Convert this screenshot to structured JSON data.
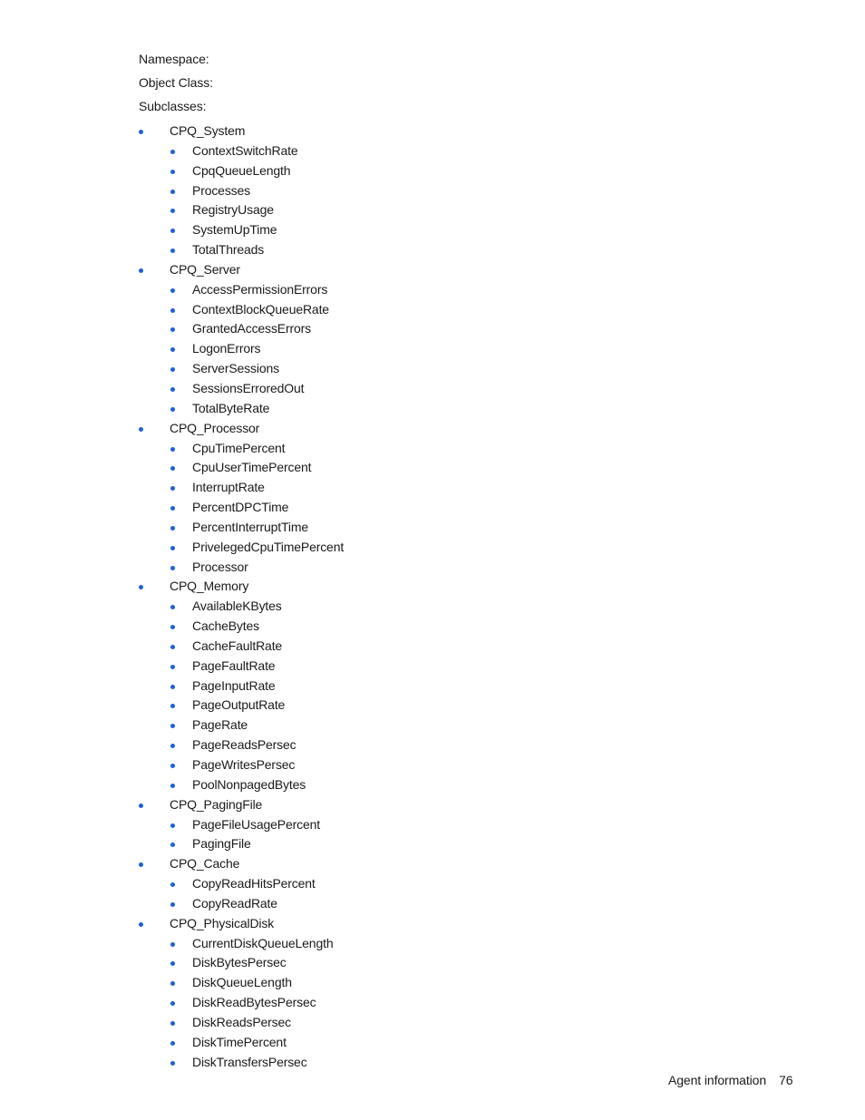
{
  "colors": {
    "bullet": "#1a62d6",
    "text": "#1a1a1a"
  },
  "fields": {
    "namespace_label": "Namespace:",
    "object_class_label": "Object Class:",
    "subclasses_label": "Subclasses:"
  },
  "subclasses": [
    {
      "name": "CPQ_System",
      "properties": [
        "ContextSwitchRate",
        "CpqQueueLength",
        "Processes",
        "RegistryUsage",
        "SystemUpTime",
        "TotalThreads"
      ]
    },
    {
      "name": "CPQ_Server",
      "properties": [
        "AccessPermissionErrors",
        "ContextBlockQueueRate",
        "GrantedAccessErrors",
        "LogonErrors",
        "ServerSessions",
        "SessionsErroredOut",
        "TotalByteRate"
      ]
    },
    {
      "name": "CPQ_Processor",
      "properties": [
        "CpuTimePercent",
        "CpuUserTimePercent",
        "InterruptRate",
        "PercentDPCTime",
        "PercentInterruptTime",
        "PrivelegedCpuTimePercent",
        "Processor"
      ]
    },
    {
      "name": "CPQ_Memory",
      "properties": [
        "AvailableKBytes",
        "CacheBytes",
        "CacheFaultRate",
        "PageFaultRate",
        "PageInputRate",
        "PageOutputRate",
        "PageRate",
        "PageReadsPersec",
        "PageWritesPersec",
        "PoolNonpagedBytes"
      ]
    },
    {
      "name": "CPQ_PagingFile",
      "properties": [
        "PageFileUsagePercent",
        "PagingFile"
      ]
    },
    {
      "name": "CPQ_Cache",
      "properties": [
        "CopyReadHitsPercent",
        "CopyReadRate"
      ]
    },
    {
      "name": "CPQ_PhysicalDisk",
      "properties": [
        "CurrentDiskQueueLength",
        "DiskBytesPersec",
        "DiskQueueLength",
        "DiskReadBytesPersec",
        "DiskReadsPersec",
        "DiskTimePercent",
        "DiskTransfersPersec"
      ]
    }
  ],
  "footer": {
    "section": "Agent information",
    "page_number": "76"
  }
}
